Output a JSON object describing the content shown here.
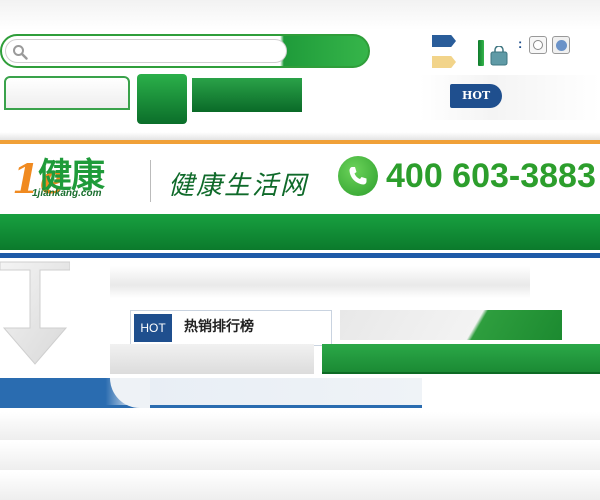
{
  "header": {
    "search": {
      "placeholder": ""
    },
    "hot_badge": "HOT",
    "colon": ":"
  },
  "brand": {
    "logo_mark": "1e",
    "logo_name": "健康",
    "logo_domain": "1jiankang.com",
    "slogan": "健康生活网",
    "phone": "400 603-3883"
  },
  "content": {
    "hot_tag": "HOT",
    "hot_list_title": "热销排行榜"
  },
  "colors": {
    "brand_green": "#1f9b3a",
    "brand_blue": "#1f4f8e",
    "accent_orange": "#f0a038"
  },
  "icons": [
    "search-icon",
    "flag-blue-icon",
    "flag-yellow-icon",
    "bag-icon",
    "phone-icon",
    "arrow-down-icon"
  ]
}
